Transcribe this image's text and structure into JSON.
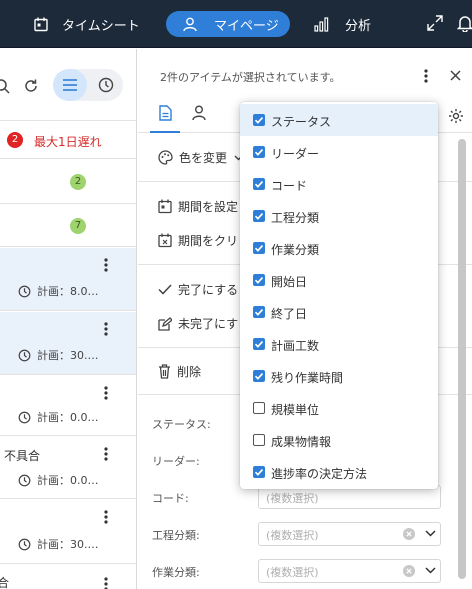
{
  "topnav": {
    "timesheet": "タイムシート",
    "mypage": "マイページ",
    "analysis": "分析"
  },
  "list": {
    "overdue": {
      "count": "2",
      "label": "最大1日遅れ"
    },
    "groups": [
      {
        "count": "2"
      },
      {
        "count": "7"
      }
    ],
    "tasks": [
      {
        "plan": "計画：8.0…",
        "selected": true
      },
      {
        "plan": "計画：30.…",
        "selected": true
      },
      {
        "plan": "計画：0.0…",
        "selected": false
      },
      {
        "name": "不具合",
        "plan": "計画：0.0…",
        "selected": false
      },
      {
        "plan": "計画：30.…",
        "selected": false
      }
    ],
    "partial_last": "合"
  },
  "detail": {
    "selection_info": "2件のアイテムが選択されています。",
    "change_color": "色を変更",
    "set_period": "期間を設定",
    "clear_period": "期間をクリ",
    "mark_done": "完了にする",
    "mark_undone": "未完了にす",
    "delete": "削除",
    "fields": {
      "status": "ステータス:",
      "leader": "リーダー:",
      "code": "コード:",
      "process": "工程分類:",
      "work": "作業分類:"
    },
    "placeholder_multi": "(複数選択)"
  },
  "column_menu": {
    "items": [
      {
        "label": "ステータス",
        "checked": true,
        "highlighted": true
      },
      {
        "label": "リーダー",
        "checked": true
      },
      {
        "label": "コード",
        "checked": true
      },
      {
        "label": "工程分類",
        "checked": true
      },
      {
        "label": "作業分類",
        "checked": true
      },
      {
        "label": "開始日",
        "checked": true
      },
      {
        "label": "終了日",
        "checked": true
      },
      {
        "label": "計画工数",
        "checked": true
      },
      {
        "label": "残り作業時間",
        "checked": true
      },
      {
        "label": "規模単位",
        "checked": false
      },
      {
        "label": "成果物情報",
        "checked": false
      },
      {
        "label": "進捗率の決定方法",
        "checked": true
      }
    ]
  },
  "colors": {
    "topbar": "#1d2a3a",
    "accent": "#2f7fd8",
    "overdue_red": "#e02424",
    "badge_green": "#9ed36d",
    "selected_row": "#e9f1fb"
  }
}
